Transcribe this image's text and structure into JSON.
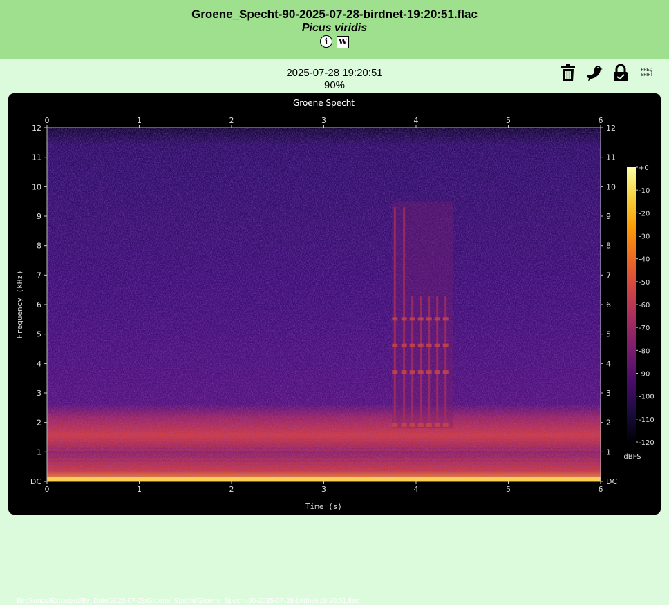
{
  "header": {
    "title": "Groene_Specht-90-2025-07-28-birdnet-19:20:51.flac",
    "species": "Picus viridis",
    "info_label": "i",
    "wiki_label": "W"
  },
  "recording": {
    "datetime": "2025-07-28 19:20:51",
    "confidence": "90%"
  },
  "actions": {
    "icons": [
      "trash-icon",
      "bird-icon",
      "lock-icon",
      "freq-shift-icon"
    ],
    "freq_shift_label": "FREQ SHIFT"
  },
  "chart_data": {
    "type": "heatmap",
    "title": "Groene Specht",
    "xlabel": "Time (s)",
    "ylabel": "Frequency (kHz)",
    "xlim": [
      0,
      6
    ],
    "ylim": [
      0,
      12
    ],
    "x_ticks": [
      "0",
      "1",
      "2",
      "3",
      "4",
      "5",
      "6"
    ],
    "y_ticks": [
      "DC",
      "1",
      "2",
      "3",
      "4",
      "5",
      "6",
      "7",
      "8",
      "9",
      "10",
      "11",
      "12"
    ],
    "colorbar": {
      "label": "dBFS",
      "range": [
        -120,
        0
      ],
      "ticks": [
        "+0",
        "-10",
        "-20",
        "-30",
        "-40",
        "-50",
        "-60",
        "-70",
        "-80",
        "-90",
        "-100",
        "-110",
        "-120"
      ]
    },
    "colormap": [
      "#000004",
      "#1b0c41",
      "#4a0c6b",
      "#781c6d",
      "#a52c60",
      "#cf4446",
      "#ed6925",
      "#fb9b06",
      "#f7d13d",
      "#fcffa4"
    ]
  },
  "file_path": "BirdSongs/Extracted/By_Date/2025-07-28/Groene_Specht/Groene_Specht-90-2025-07-28-birdnet-19:20:51.flac"
}
